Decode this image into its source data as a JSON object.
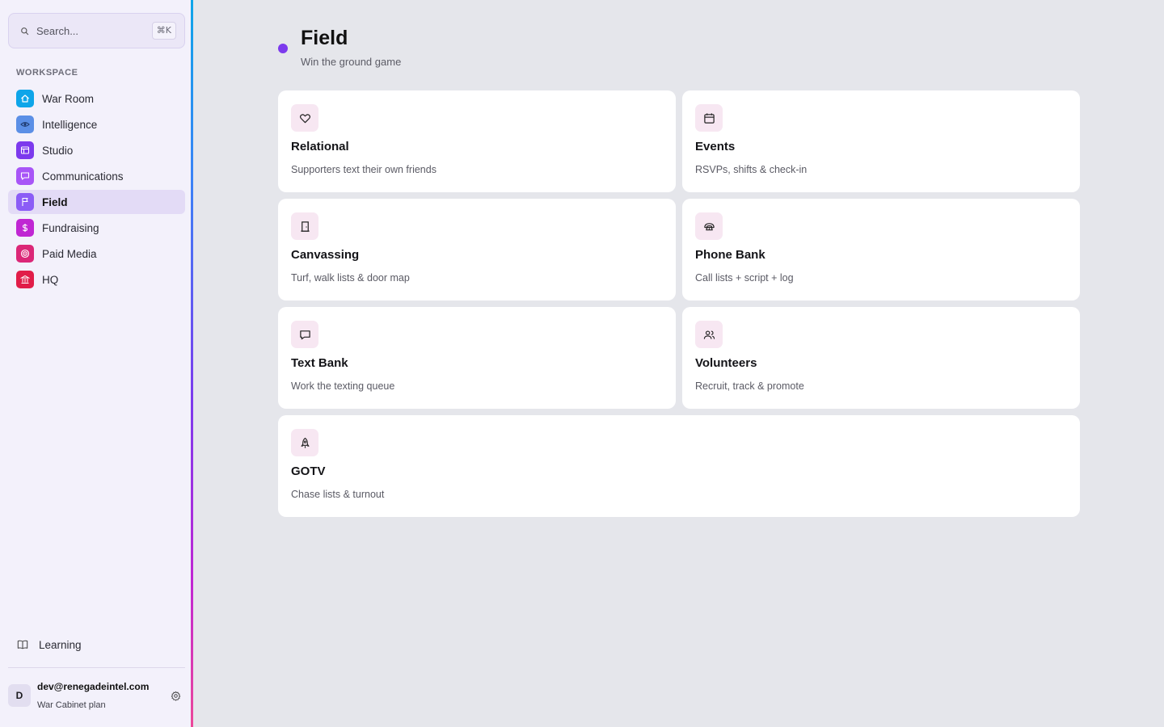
{
  "search": {
    "placeholder": "Search...",
    "shortcut": "⌘K",
    "icon": "search-icon"
  },
  "sidebar": {
    "section_label": "WORKSPACE",
    "items": [
      {
        "label": "War Room",
        "icon": "home-icon",
        "color": "#0ea5e9",
        "active": false
      },
      {
        "label": "Intelligence",
        "icon": "eye-icon",
        "color": "#3b82f6",
        "active": false
      },
      {
        "label": "Studio",
        "icon": "layout-icon",
        "color": "#7c3aed",
        "active": false
      },
      {
        "label": "Communications",
        "icon": "message-icon",
        "color": "#a855f7",
        "active": false
      },
      {
        "label": "Field",
        "icon": "flag-icon",
        "color": "#8b5cf6",
        "active": true
      },
      {
        "label": "Fundraising",
        "icon": "dollar-icon",
        "color": "#c026d3",
        "active": false
      },
      {
        "label": "Paid Media",
        "icon": "target-icon",
        "color": "#db2777",
        "active": false
      },
      {
        "label": "HQ",
        "icon": "building-icon",
        "color": "#e11d48",
        "active": false
      }
    ],
    "learning": {
      "label": "Learning",
      "icon": "book-icon"
    },
    "user": {
      "initial": "D",
      "email": "dev@renegadeintel.com",
      "plan": "War Cabinet plan",
      "settings_icon": "gear-icon"
    }
  },
  "page": {
    "title": "Field",
    "subtitle": "Win the ground game",
    "accent": "#7c3aed"
  },
  "cards": [
    {
      "title": "Relational",
      "desc": "Supporters text their own friends",
      "icon": "heart-icon"
    },
    {
      "title": "Events",
      "desc": "RSVPs, shifts & check-in",
      "icon": "calendar-icon"
    },
    {
      "title": "Canvassing",
      "desc": "Turf, walk lists & door map",
      "icon": "door-icon"
    },
    {
      "title": "Phone Bank",
      "desc": "Call lists + script + log",
      "icon": "phone-icon"
    },
    {
      "title": "Text Bank",
      "desc": "Work the texting queue",
      "icon": "chat-icon"
    },
    {
      "title": "Volunteers",
      "desc": "Recruit, track & promote",
      "icon": "users-icon"
    },
    {
      "title": "GOTV",
      "desc": "Chase lists & turnout",
      "icon": "rocket-icon"
    }
  ]
}
